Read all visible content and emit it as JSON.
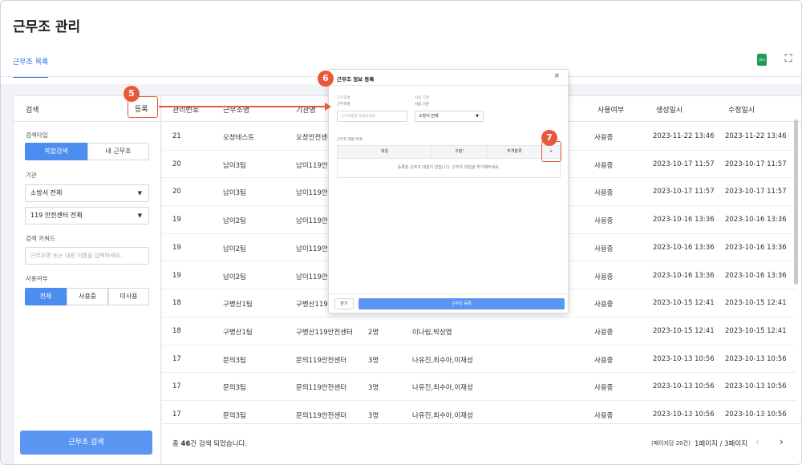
{
  "page": {
    "title": "근무조 관리",
    "tab": "근무조 목록",
    "excel_icon_text": "XLS"
  },
  "left": {
    "header": "검색",
    "register": "등록",
    "search_type_label": "검색타입",
    "search_type_options": [
      "복합검색",
      "내 근무조"
    ],
    "agency_label": "기관",
    "agency_select": "소방서 전체",
    "center_select": "119 안전센터 전체",
    "keyword_label": "검색 키워드",
    "keyword_placeholder": "근무조명 또는 대원 이름을 입력하세요.",
    "usage_label": "사용여부",
    "usage_options": [
      "전체",
      "사용중",
      "미사용"
    ],
    "search_button": "근무조 검색"
  },
  "table": {
    "headers": [
      "관리번호",
      "근무조명",
      "기관명",
      "사용여부",
      "생성일시",
      "수정일시"
    ],
    "rows": [
      {
        "no": "21",
        "name": "오창테스트",
        "agency": "오창안전센터",
        "count": "",
        "members": "",
        "status": "사용중",
        "created": "2023-11-22 13:46",
        "updated": "2023-11-22 13:46"
      },
      {
        "no": "20",
        "name": "남이3팀",
        "agency": "남이119안전",
        "count": "",
        "members": "",
        "status": "사용중",
        "created": "2023-10-17 11:57",
        "updated": "2023-10-17 11:57"
      },
      {
        "no": "20",
        "name": "남이3팀",
        "agency": "남이119안전",
        "count": "",
        "members": "",
        "status": "사용중",
        "created": "2023-10-17 11:57",
        "updated": "2023-10-17 11:57"
      },
      {
        "no": "19",
        "name": "남이2팀",
        "agency": "남이119안전",
        "count": "",
        "members": "",
        "status": "사용중",
        "created": "2023-10-16 13:36",
        "updated": "2023-10-16 13:36"
      },
      {
        "no": "19",
        "name": "남이2팀",
        "agency": "남이119안전",
        "count": "",
        "members": "",
        "status": "사용중",
        "created": "2023-10-16 13:36",
        "updated": "2023-10-16 13:36"
      },
      {
        "no": "19",
        "name": "남이2팀",
        "agency": "남이119안전",
        "count": "",
        "members": "",
        "status": "사용중",
        "created": "2023-10-16 13:36",
        "updated": "2023-10-16 13:36"
      },
      {
        "no": "18",
        "name": "구병산1팀",
        "agency": "구병산119안",
        "count": "",
        "members": "",
        "status": "사용중",
        "created": "2023-10-15 12:41",
        "updated": "2023-10-15 12:41"
      },
      {
        "no": "18",
        "name": "구병산1팀",
        "agency": "구병산119안전센터",
        "count": "2명",
        "members": "이나림,박상엽",
        "status": "사용중",
        "created": "2023-10-15 12:41",
        "updated": "2023-10-15 12:41"
      },
      {
        "no": "17",
        "name": "문의3팀",
        "agency": "문의119안전센터",
        "count": "3명",
        "members": "나유진,최수아,이재성",
        "status": "사용중",
        "created": "2023-10-13 10:56",
        "updated": "2023-10-13 10:56"
      },
      {
        "no": "17",
        "name": "문의3팀",
        "agency": "문의119안전센터",
        "count": "3명",
        "members": "나유진,최수아,이재성",
        "status": "사용중",
        "created": "2023-10-13 10:56",
        "updated": "2023-10-13 10:56"
      },
      {
        "no": "17",
        "name": "문의3팀",
        "agency": "문의119안전센터",
        "count": "3명",
        "members": "나유진,최수아,이재성",
        "status": "사용중",
        "created": "2023-10-13 10:56",
        "updated": "2023-10-13 10:56"
      }
    ]
  },
  "footer": {
    "total_prefix": "총 ",
    "total_count": "46",
    "total_suffix": "건 검색 되었습니다.",
    "per_page": "(페이지당 20건)",
    "page_info": "1페이지 / 3페이지",
    "prev": "‹",
    "next": "›"
  },
  "modal": {
    "title": "근무조 정보 등록",
    "close": "×",
    "name_label_top": "근무조명",
    "name_label": "근무조명",
    "name_placeholder": "근무조명을 입력하세요.",
    "agency_label_top": "사용 기관",
    "agency_label": "사용 기관",
    "agency_select": "소방서 전체",
    "member_list_label": "근무조 대원 목록",
    "member_headers": [
      "대원",
      "구분",
      "자격분류",
      "+"
    ],
    "required_mark": "*",
    "empty_message": "등록된 근무조 대원이 없습니다. 근무조 대원을 추가해주세요.",
    "close_button": "닫기",
    "submit_button": "근무조 등록"
  },
  "annotations": [
    "5",
    "6",
    "7"
  ],
  "colors": {
    "accent": "#2f6fe0",
    "primary_button": "#5b97f2",
    "annotation": "#e8593c"
  }
}
